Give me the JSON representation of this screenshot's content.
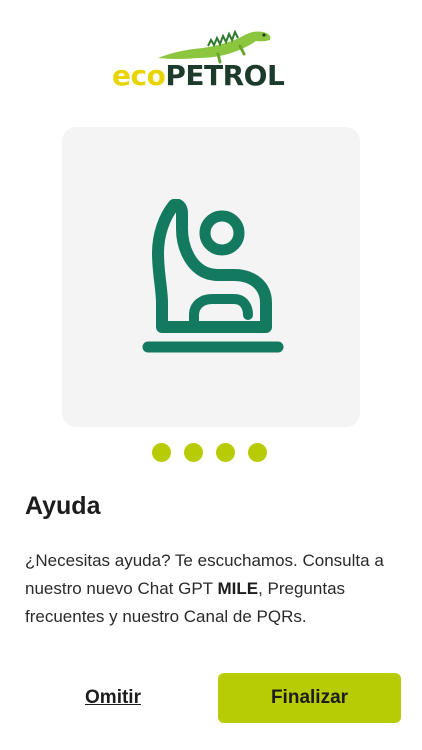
{
  "brand": {
    "logo_text_part1": "eco",
    "logo_text_part2": "PETROL",
    "colors": {
      "eco": "#e8d500",
      "petrol": "#1d3b2a",
      "accent": "#b8cc05",
      "icon": "#137a5f"
    }
  },
  "slide": {
    "icon": "hand-support-icon",
    "title": "Ayuda",
    "description_before": "¿Necesitas ayuda? Te escuchamos. Consulta a nuestro nuevo Chat GPT ",
    "description_bold": "MILE",
    "description_after": ", Preguntas frecuentes y nuestro Canal de PQRs."
  },
  "pagination": {
    "total": 4,
    "current": 4
  },
  "actions": {
    "skip_label": "Omitir",
    "finish_label": "Finalizar"
  }
}
